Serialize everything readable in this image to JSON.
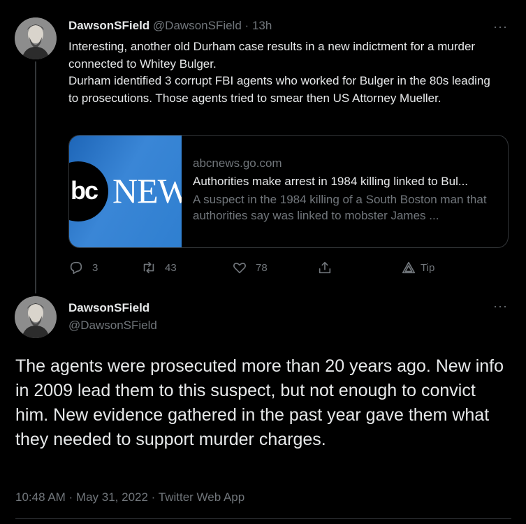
{
  "tweet1": {
    "display_name": "DawsonSField",
    "handle": "@DawsonSField",
    "separator": "·",
    "time": "13h",
    "text_lines": [
      "Interesting, another old Durham case results in a new indictment for a murder connected to Whitey Bulger.",
      "Durham identified 3 corrupt FBI agents who worked for Bulger in the 80s leading to prosecutions. Those agents tried to smear then US Attorney Mueller."
    ],
    "card": {
      "image_text_left": "bc",
      "image_text_right": "NEW",
      "domain": "abcnews.go.com",
      "title": "Authorities make arrest in 1984 killing linked to Bul...",
      "description": "A suspect in the 1984 killing of a South Boston man that authorities say was linked to mobster James ..."
    },
    "actions": {
      "replies": "3",
      "retweets": "43",
      "likes": "78",
      "tip_label": "Tip"
    },
    "more_label": "···"
  },
  "tweet2": {
    "display_name": "DawsonSField",
    "handle": "@DawsonSField",
    "text": "The agents were prosecuted more than 20 years ago. New info in 2009 lead them to this suspect, but not enough to convict him. New evidence gathered in the past year gave them what they needed to support murder charges.",
    "meta": "10:48 AM · May 31, 2022 · Twitter Web App",
    "more_label": "···"
  },
  "icons": {
    "reply": "reply-icon",
    "retweet": "retweet-icon",
    "like": "heart-icon",
    "share": "share-icon",
    "tip": "tip-icon",
    "more": "more-icon"
  },
  "colors": {
    "background": "#000000",
    "text": "#e7e9ea",
    "muted": "#71767b",
    "border": "#333639"
  }
}
